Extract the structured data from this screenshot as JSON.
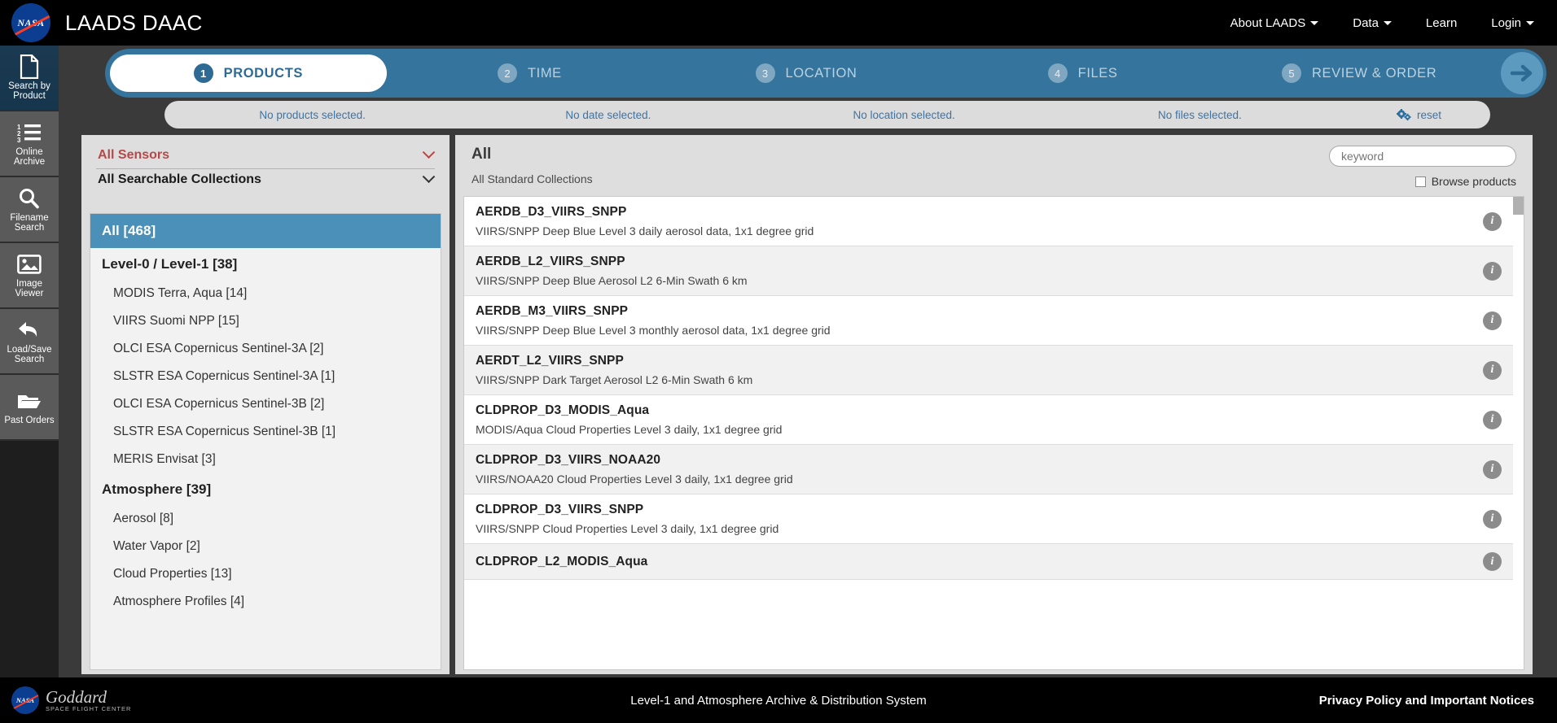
{
  "header": {
    "logo_alt": "NASA",
    "logo_word": "NASA",
    "title": "LAADS DAAC",
    "nav": [
      {
        "label": "About LAADS",
        "has_caret": true
      },
      {
        "label": "Data",
        "has_caret": true
      },
      {
        "label": "Learn",
        "has_caret": false
      },
      {
        "label": "Login",
        "has_caret": true
      }
    ]
  },
  "sidebar": {
    "items": [
      {
        "label_line1": "Search by",
        "label_line2": "Product",
        "icon": "document-icon",
        "active": true
      },
      {
        "label_line1": "Online",
        "label_line2": "Archive",
        "icon": "ordered-list-icon",
        "active": false
      },
      {
        "label_line1": "Filename",
        "label_line2": "Search",
        "icon": "search-icon",
        "active": false
      },
      {
        "label_line1": "Image",
        "label_line2": "Viewer",
        "icon": "image-icon",
        "active": false
      },
      {
        "label_line1": "Load/Save",
        "label_line2": "Search",
        "icon": "undo-arrow-icon",
        "active": false
      },
      {
        "label_line1": "Past Orders",
        "label_line2": "",
        "icon": "folder-open-icon",
        "active": false
      }
    ]
  },
  "stepper": {
    "steps": [
      {
        "num": "1",
        "label": "PRODUCTS",
        "active": true
      },
      {
        "num": "2",
        "label": "TIME",
        "active": false
      },
      {
        "num": "3",
        "label": "LOCATION",
        "active": false
      },
      {
        "num": "4",
        "label": "FILES",
        "active": false
      },
      {
        "num": "5",
        "label": "REVIEW & ORDER",
        "active": false
      }
    ],
    "next_icon": "arrow-right-icon"
  },
  "summary": {
    "cells": [
      "No products selected.",
      "No date selected.",
      "No location selected.",
      "No files selected."
    ],
    "reset_label": "reset",
    "reset_icon": "gears-icon"
  },
  "filters": {
    "sensor_dropdown": {
      "label": "All Sensors",
      "icon": "chevron-down-icon"
    },
    "collection_dropdown": {
      "label": "All Searchable Collections",
      "icon": "chevron-down-icon"
    },
    "categories": [
      {
        "label": "All [468]",
        "type": "all"
      },
      {
        "label": "Level-0 / Level-1 [38]",
        "type": "group"
      },
      {
        "label": "MODIS Terra, Aqua [14]",
        "type": "item"
      },
      {
        "label": "VIIRS Suomi NPP [15]",
        "type": "item"
      },
      {
        "label": "OLCI ESA Copernicus Sentinel-3A [2]",
        "type": "item"
      },
      {
        "label": "SLSTR ESA Copernicus Sentinel-3A [1]",
        "type": "item"
      },
      {
        "label": "OLCI ESA Copernicus Sentinel-3B [2]",
        "type": "item"
      },
      {
        "label": "SLSTR ESA Copernicus Sentinel-3B [1]",
        "type": "item"
      },
      {
        "label": "MERIS Envisat [3]",
        "type": "item"
      },
      {
        "label": "Atmosphere [39]",
        "type": "group"
      },
      {
        "label": "Aerosol [8]",
        "type": "item"
      },
      {
        "label": "Water Vapor [2]",
        "type": "item"
      },
      {
        "label": "Cloud Properties [13]",
        "type": "item"
      },
      {
        "label": "Atmosphere Profiles [4]",
        "type": "item"
      }
    ]
  },
  "results": {
    "title": "All",
    "subtitle": "All Standard Collections",
    "keyword_placeholder": "keyword",
    "keyword_value": "",
    "browse_label": "Browse products",
    "browse_checked": false,
    "info_icon": "info-icon",
    "products": [
      {
        "name": "AERDB_D3_VIIRS_SNPP",
        "desc": "VIIRS/SNPP Deep Blue Level 3 daily aerosol data, 1x1 degree grid"
      },
      {
        "name": "AERDB_L2_VIIRS_SNPP",
        "desc": "VIIRS/SNPP Deep Blue Aerosol L2 6-Min Swath 6 km"
      },
      {
        "name": "AERDB_M3_VIIRS_SNPP",
        "desc": "VIIRS/SNPP Deep Blue Level 3 monthly aerosol data, 1x1 degree grid"
      },
      {
        "name": "AERDT_L2_VIIRS_SNPP",
        "desc": "VIIRS/SNPP Dark Target Aerosol L2 6-Min Swath 6 km"
      },
      {
        "name": "CLDPROP_D3_MODIS_Aqua",
        "desc": "MODIS/Aqua Cloud Properties Level 3 daily, 1x1 degree grid"
      },
      {
        "name": "CLDPROP_D3_VIIRS_NOAA20",
        "desc": "VIIRS/NOAA20 Cloud Properties Level 3 daily, 1x1 degree grid"
      },
      {
        "name": "CLDPROP_D3_VIIRS_SNPP",
        "desc": "VIIRS/SNPP Cloud Properties Level 3 daily, 1x1 degree grid"
      },
      {
        "name": "CLDPROP_L2_MODIS_Aqua",
        "desc": ""
      }
    ]
  },
  "footer": {
    "goddard_main": "Goddard",
    "goddard_sub": "SPACE FLIGHT CENTER",
    "center_text": "Level-1 and Atmosphere Archive & Distribution System",
    "right_link": "Privacy Policy and Important Notices"
  },
  "colors": {
    "accent_blue": "#35749c",
    "active_blue": "#4a90b9",
    "link_blue": "#3f73a3",
    "sensor_red": "#b34a4a",
    "dark_bg": "#3a3a3a"
  }
}
